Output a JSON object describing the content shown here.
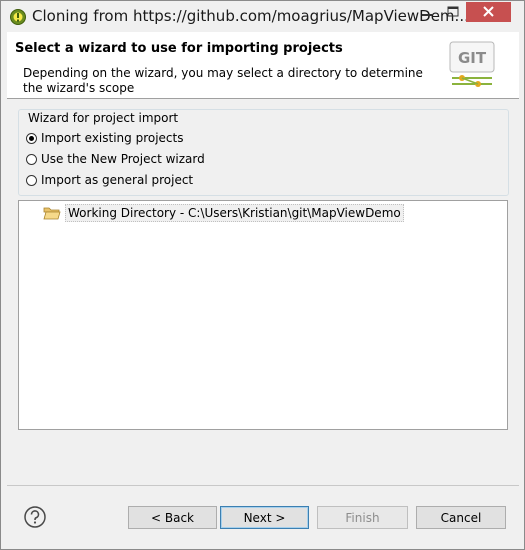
{
  "window": {
    "title": "Cloning from https://github.com/moagrius/MapViewDem...",
    "minimize_icon": "minimize-icon",
    "maximize_icon": "maximize-icon",
    "close_icon": "close-icon"
  },
  "banner": {
    "title": "Select a wizard to use for importing projects",
    "description": "Depending on the wizard, you may select a directory to determine the wizard's scope",
    "logo_text": "GIT"
  },
  "wizard_group": {
    "legend": "Wizard for project import",
    "options": [
      {
        "label": "Import existing projects",
        "selected": true
      },
      {
        "label": "Use the New Project wizard",
        "selected": false
      },
      {
        "label": "Import as general project",
        "selected": false
      }
    ]
  },
  "tree": {
    "items": [
      {
        "label": "Working Directory - C:\\Users\\Kristian\\git\\MapViewDemo",
        "icon": "folder-open-icon"
      }
    ]
  },
  "buttons": {
    "back": "< Back",
    "next": "Next >",
    "finish": "Finish",
    "cancel": "Cancel"
  },
  "colors": {
    "close_button": "#c75050",
    "default_button_border": "#3c7fb1"
  }
}
